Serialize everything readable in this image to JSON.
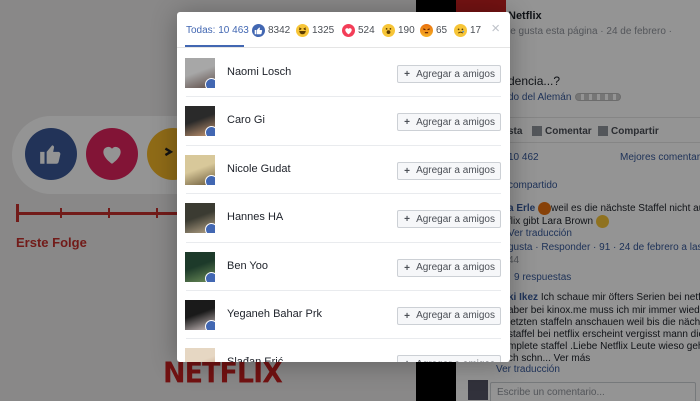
{
  "video": {
    "episode_label": "Erste Folge",
    "brand_logo": "NETFLIX"
  },
  "sidebar": {
    "page_name": "Netflix",
    "page_meta": "le gusta esta página · 24 de febrero ·",
    "post_text": "dencia...?",
    "post_sub": "do del Alemán",
    "actions": {
      "like": "sta",
      "comment": "Comentar",
      "share": "Compartir"
    },
    "count": "10 462",
    "best_comments": "Mejores comentario",
    "shared": "compartido",
    "comment1_name": "a Erle",
    "comment1_text_1": "weil es die nächste Staffel nicht auf",
    "comment1_text_2": "flix gibt Lara Brown",
    "comment1_translation": "Ver traducción",
    "comment1_meta": "gusta · Responder · 91 · 24 de febrero a las",
    "comment1_count": "44",
    "replies": "9 respuestas",
    "comment2_name": "ki Ikez",
    "comment2_text_1": "Ich schaue mir öfters Serien bei netflix",
    "comment2_text_2": "aber bei kinox.me muss ich mir immer wieder",
    "comment2_text_3": "letzten staffeln anschauen weil bis die nächste",
    "comment2_text_4": "staffel bei netflix erscheint vergisst mann die",
    "comment2_text_5": "mplete staffel .Liebe Netflix Leute wieso geht es",
    "comment2_text_6": "ch schn... Ver más",
    "comment2_translation": "Ver traducción",
    "comment_placeholder": "Escribe un comentario..."
  },
  "dialog": {
    "tabs": {
      "all": "Todas: 10 463",
      "like": "8342",
      "haha": "1325",
      "love": "524",
      "wow": "190",
      "angry": "65",
      "sad": "17"
    },
    "close": "×",
    "add_label": "Agregar a amigos",
    "people": [
      {
        "name": "Naomi Losch"
      },
      {
        "name": "Caro Gi"
      },
      {
        "name": "Nicole Gudat"
      },
      {
        "name": "Hannes HA"
      },
      {
        "name": "Ben Yoo"
      },
      {
        "name": "Yeganeh Bahar Prk"
      },
      {
        "name": "Slađan Erić"
      }
    ]
  },
  "colors": {
    "facebook_blue": "#4267b2",
    "netflix_red": "#c61f1f"
  }
}
